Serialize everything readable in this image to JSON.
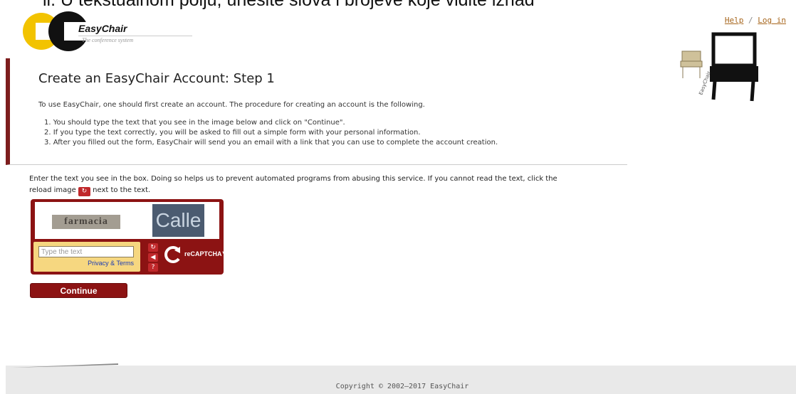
{
  "overlay_text": "ii.     U tekstualnom polju, unesite slova i brojeve koje vidite iznad",
  "logo": {
    "name": "EasyChair",
    "tagline": "The conference system"
  },
  "top_links": {
    "help": "Help",
    "separator": "/",
    "login": "Log in"
  },
  "page_title": "Create an EasyChair Account: Step 1",
  "intro": "To use EasyChair, one should first create an account. The procedure for creating an account is the following.",
  "steps": [
    "1. You should type the text that you see in the image below and click on \"Continue\".",
    "2. If you type the text correctly, you will be asked to fill out a simple form with your personal information.",
    "3. After you filled out the form, EasyChair will send you an email with a link that you can use to complete the account creation."
  ],
  "instructions": {
    "part1": "Enter the text you see in the box. Doing so helps us to prevent automated programs from abusing this service. If you cannot read the text, click the reload image",
    "part2": "next to the text."
  },
  "recaptcha": {
    "words": [
      "farmacia",
      "Calle"
    ],
    "placeholder": "Type the text",
    "privacy_link": "Privacy & Terms",
    "logo_text": "reCAPTCHA™",
    "icons": [
      "reload-icon",
      "audio-icon",
      "help-icon"
    ]
  },
  "continue_button": "Continue",
  "footer": {
    "copyright": "Copyright © 2002–2017 EasyChair"
  },
  "colors": {
    "accent": "#8c1313",
    "link": "#a7661d",
    "logo_yellow": "#f2c300",
    "captcha_input_bg": "#f6d780"
  }
}
